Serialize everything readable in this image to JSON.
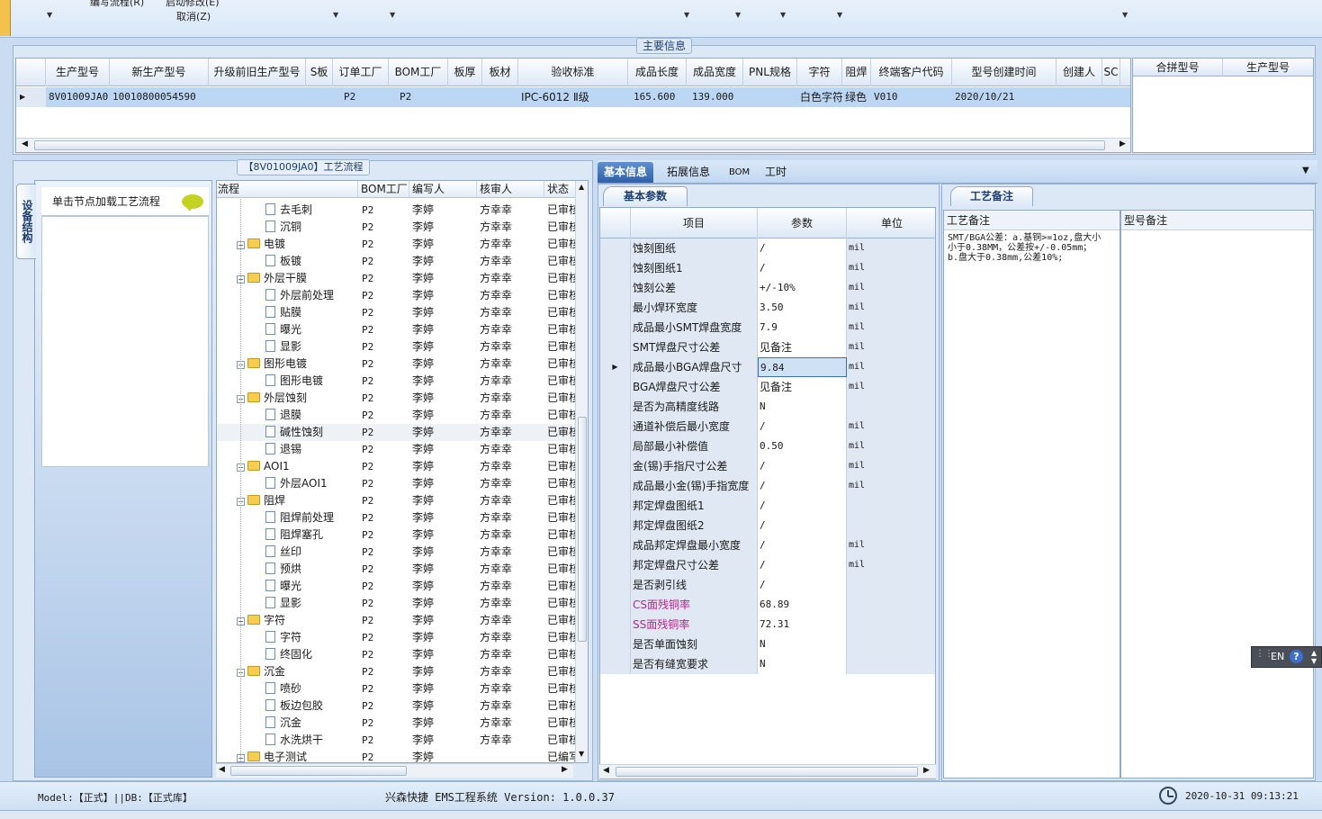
{
  "top_menu": {
    "item1": "编写流程(R)",
    "item2": "启动修改(E)",
    "cancel": "取消(Z)"
  },
  "main_info": {
    "title": "主要信息",
    "columns": [
      "生产型号",
      "新生产型号",
      "升级前旧生产型号",
      "S板",
      "订单工厂",
      "BOM工厂",
      "板厚",
      "板材",
      "验收标准",
      "成品长度",
      "成品宽度",
      "PNL规格",
      "字符",
      "阻焊",
      "终端客户代码",
      "型号创建时间",
      "创建人",
      "SC"
    ],
    "row": [
      "8V01009JA0",
      "10010800054590",
      "",
      "",
      "P2",
      "P2",
      "",
      "",
      "IPC-6012 Ⅱ级",
      "165.600",
      "139.000",
      "",
      "白色字符",
      "绿色",
      "V010",
      "2020/10/21",
      "",
      ""
    ],
    "merge_columns": [
      "合拼型号",
      "生产型号"
    ]
  },
  "process": {
    "title": "【8V01009JA0】工艺流程",
    "side_tab": "设备结构",
    "hint": "单击节点加载工艺流程",
    "columns": [
      "流程",
      "BOM工厂",
      "编写人",
      "核审人",
      "状态"
    ],
    "rows": [
      {
        "name": "去毛刺",
        "level": 2,
        "folder": false,
        "bom": "P2",
        "writer": "李婷",
        "reviewer": "方幸幸",
        "status": "已审核"
      },
      {
        "name": "沉铜",
        "level": 2,
        "folder": false,
        "bom": "P2",
        "writer": "李婷",
        "reviewer": "方幸幸",
        "status": "已审核"
      },
      {
        "name": "电镀",
        "level": 1,
        "folder": true,
        "bom": "P2",
        "writer": "李婷",
        "reviewer": "方幸幸",
        "status": "已审核"
      },
      {
        "name": "板镀",
        "level": 2,
        "folder": false,
        "bom": "P2",
        "writer": "李婷",
        "reviewer": "方幸幸",
        "status": "已审核"
      },
      {
        "name": "外层干膜",
        "level": 1,
        "folder": true,
        "bom": "P2",
        "writer": "李婷",
        "reviewer": "方幸幸",
        "status": "已审核"
      },
      {
        "name": "外层前处理",
        "level": 2,
        "folder": false,
        "bom": "P2",
        "writer": "李婷",
        "reviewer": "方幸幸",
        "status": "已审核"
      },
      {
        "name": "贴膜",
        "level": 2,
        "folder": false,
        "bom": "P2",
        "writer": "李婷",
        "reviewer": "方幸幸",
        "status": "已审核"
      },
      {
        "name": "曝光",
        "level": 2,
        "folder": false,
        "bom": "P2",
        "writer": "李婷",
        "reviewer": "方幸幸",
        "status": "已审核"
      },
      {
        "name": "显影",
        "level": 2,
        "folder": false,
        "bom": "P2",
        "writer": "李婷",
        "reviewer": "方幸幸",
        "status": "已审核"
      },
      {
        "name": "图形电镀",
        "level": 1,
        "folder": true,
        "bom": "P2",
        "writer": "李婷",
        "reviewer": "方幸幸",
        "status": "已审核"
      },
      {
        "name": "图形电镀",
        "level": 2,
        "folder": false,
        "bom": "P2",
        "writer": "李婷",
        "reviewer": "方幸幸",
        "status": "已审核"
      },
      {
        "name": "外层蚀刻",
        "level": 1,
        "folder": true,
        "bom": "P2",
        "writer": "李婷",
        "reviewer": "方幸幸",
        "status": "已审核"
      },
      {
        "name": "退膜",
        "level": 2,
        "folder": false,
        "bom": "P2",
        "writer": "李婷",
        "reviewer": "方幸幸",
        "status": "已审核"
      },
      {
        "name": "碱性蚀刻",
        "level": 2,
        "folder": false,
        "bom": "P2",
        "writer": "李婷",
        "reviewer": "方幸幸",
        "status": "已审核",
        "selected": true
      },
      {
        "name": "退锡",
        "level": 2,
        "folder": false,
        "bom": "P2",
        "writer": "李婷",
        "reviewer": "方幸幸",
        "status": "已审核"
      },
      {
        "name": "AOI1",
        "level": 1,
        "folder": true,
        "bom": "P2",
        "writer": "李婷",
        "reviewer": "方幸幸",
        "status": "已审核"
      },
      {
        "name": "外层AOI1",
        "level": 2,
        "folder": false,
        "bom": "P2",
        "writer": "李婷",
        "reviewer": "方幸幸",
        "status": "已审核"
      },
      {
        "name": "阻焊",
        "level": 1,
        "folder": true,
        "bom": "P2",
        "writer": "李婷",
        "reviewer": "方幸幸",
        "status": "已审核"
      },
      {
        "name": "阻焊前处理",
        "level": 2,
        "folder": false,
        "bom": "P2",
        "writer": "李婷",
        "reviewer": "方幸幸",
        "status": "已审核"
      },
      {
        "name": "阻焊塞孔",
        "level": 2,
        "folder": false,
        "bom": "P2",
        "writer": "李婷",
        "reviewer": "方幸幸",
        "status": "已审核"
      },
      {
        "name": "丝印",
        "level": 2,
        "folder": false,
        "bom": "P2",
        "writer": "李婷",
        "reviewer": "方幸幸",
        "status": "已审核"
      },
      {
        "name": "预烘",
        "level": 2,
        "folder": false,
        "bom": "P2",
        "writer": "李婷",
        "reviewer": "方幸幸",
        "status": "已审核"
      },
      {
        "name": "曝光",
        "level": 2,
        "folder": false,
        "bom": "P2",
        "writer": "李婷",
        "reviewer": "方幸幸",
        "status": "已审核"
      },
      {
        "name": "显影",
        "level": 2,
        "folder": false,
        "bom": "P2",
        "writer": "李婷",
        "reviewer": "方幸幸",
        "status": "已审核"
      },
      {
        "name": "字符",
        "level": 1,
        "folder": true,
        "bom": "P2",
        "writer": "李婷",
        "reviewer": "方幸幸",
        "status": "已审核"
      },
      {
        "name": "字符",
        "level": 2,
        "folder": false,
        "bom": "P2",
        "writer": "李婷",
        "reviewer": "方幸幸",
        "status": "已审核"
      },
      {
        "name": "终固化",
        "level": 2,
        "folder": false,
        "bom": "P2",
        "writer": "李婷",
        "reviewer": "方幸幸",
        "status": "已审核"
      },
      {
        "name": "沉金",
        "level": 1,
        "folder": true,
        "bom": "P2",
        "writer": "李婷",
        "reviewer": "方幸幸",
        "status": "已审核"
      },
      {
        "name": "喷砂",
        "level": 2,
        "folder": false,
        "bom": "P2",
        "writer": "李婷",
        "reviewer": "方幸幸",
        "status": "已审核"
      },
      {
        "name": "板边包胶",
        "level": 2,
        "folder": false,
        "bom": "P2",
        "writer": "李婷",
        "reviewer": "方幸幸",
        "status": "已审核"
      },
      {
        "name": "沉金",
        "level": 2,
        "folder": false,
        "bom": "P2",
        "writer": "李婷",
        "reviewer": "方幸幸",
        "status": "已审核"
      },
      {
        "name": "水洗烘干",
        "level": 2,
        "folder": false,
        "bom": "P2",
        "writer": "李婷",
        "reviewer": "方幸幸",
        "status": "已审核"
      },
      {
        "name": "电子测试",
        "level": 1,
        "folder": true,
        "bom": "P2",
        "writer": "李婷",
        "reviewer": "",
        "status": "已编写"
      }
    ]
  },
  "detail_tabs": [
    "基本信息",
    "拓展信息",
    "BOM",
    "工时"
  ],
  "basic_params": {
    "title": "基本参数",
    "columns": [
      "项目",
      "参数",
      "单位"
    ],
    "rows": [
      {
        "item": "蚀刻图纸",
        "value": "/",
        "unit": "mil"
      },
      {
        "item": "蚀刻图纸1",
        "value": "/",
        "unit": "mil"
      },
      {
        "item": "蚀刻公差",
        "value": "+/-10%",
        "unit": "mil"
      },
      {
        "item": "最小焊环宽度",
        "value": "3.50",
        "unit": "mil"
      },
      {
        "item": "成品最小SMT焊盘宽度",
        "value": "7.9",
        "unit": "mil"
      },
      {
        "item": "SMT焊盘尺寸公差",
        "value": "见备注",
        "unit": "mil"
      },
      {
        "item": "成品最小BGA焊盘尺寸",
        "value": "9.84",
        "unit": "mil",
        "current": true
      },
      {
        "item": "BGA焊盘尺寸公差",
        "value": "见备注",
        "unit": "mil"
      },
      {
        "item": "是否为高精度线路",
        "value": "N",
        "unit": ""
      },
      {
        "item": "通道补偿后最小宽度",
        "value": "/",
        "unit": "mil"
      },
      {
        "item": "局部最小补偿值",
        "value": "0.50",
        "unit": "mil"
      },
      {
        "item": "金(锡)手指尺寸公差",
        "value": "/",
        "unit": "mil"
      },
      {
        "item": "成品最小金(锡)手指宽度",
        "value": "/",
        "unit": "mil"
      },
      {
        "item": "邦定焊盘图纸1",
        "value": "/",
        "unit": ""
      },
      {
        "item": "邦定焊盘图纸2",
        "value": "/",
        "unit": ""
      },
      {
        "item": "成品邦定焊盘最小宽度",
        "value": "/",
        "unit": "mil"
      },
      {
        "item": "邦定焊盘尺寸公差",
        "value": "/",
        "unit": "mil"
      },
      {
        "item": "是否剥引线",
        "value": "/",
        "unit": ""
      },
      {
        "item": "CS面残铜率",
        "value": "68.89",
        "unit": "",
        "pink": true
      },
      {
        "item": "SS面残铜率",
        "value": "72.31",
        "unit": "",
        "pink": true
      },
      {
        "item": "是否单面蚀刻",
        "value": "N",
        "unit": ""
      },
      {
        "item": "是否有缝宽要求",
        "value": "N",
        "unit": ""
      }
    ]
  },
  "remarks": {
    "title": "工艺备注",
    "process_remark_label": "工艺备注",
    "model_remark_label": "型号备注",
    "process_remark_text": "SMT/BGA公差：a.基铜>=1oz,盘大小小于0.38MM，公差按+/-0.05mm；b.盘大于0.38mm,公差10%;"
  },
  "ime": {
    "lang": "EN",
    "help": "?"
  },
  "status": {
    "model_db": "Model:【正式】||DB:【正式库】",
    "app": "兴森快捷 EMS工程系统 Version: 1.0.0.37",
    "datetime": "2020-10-31 09:13:21"
  }
}
